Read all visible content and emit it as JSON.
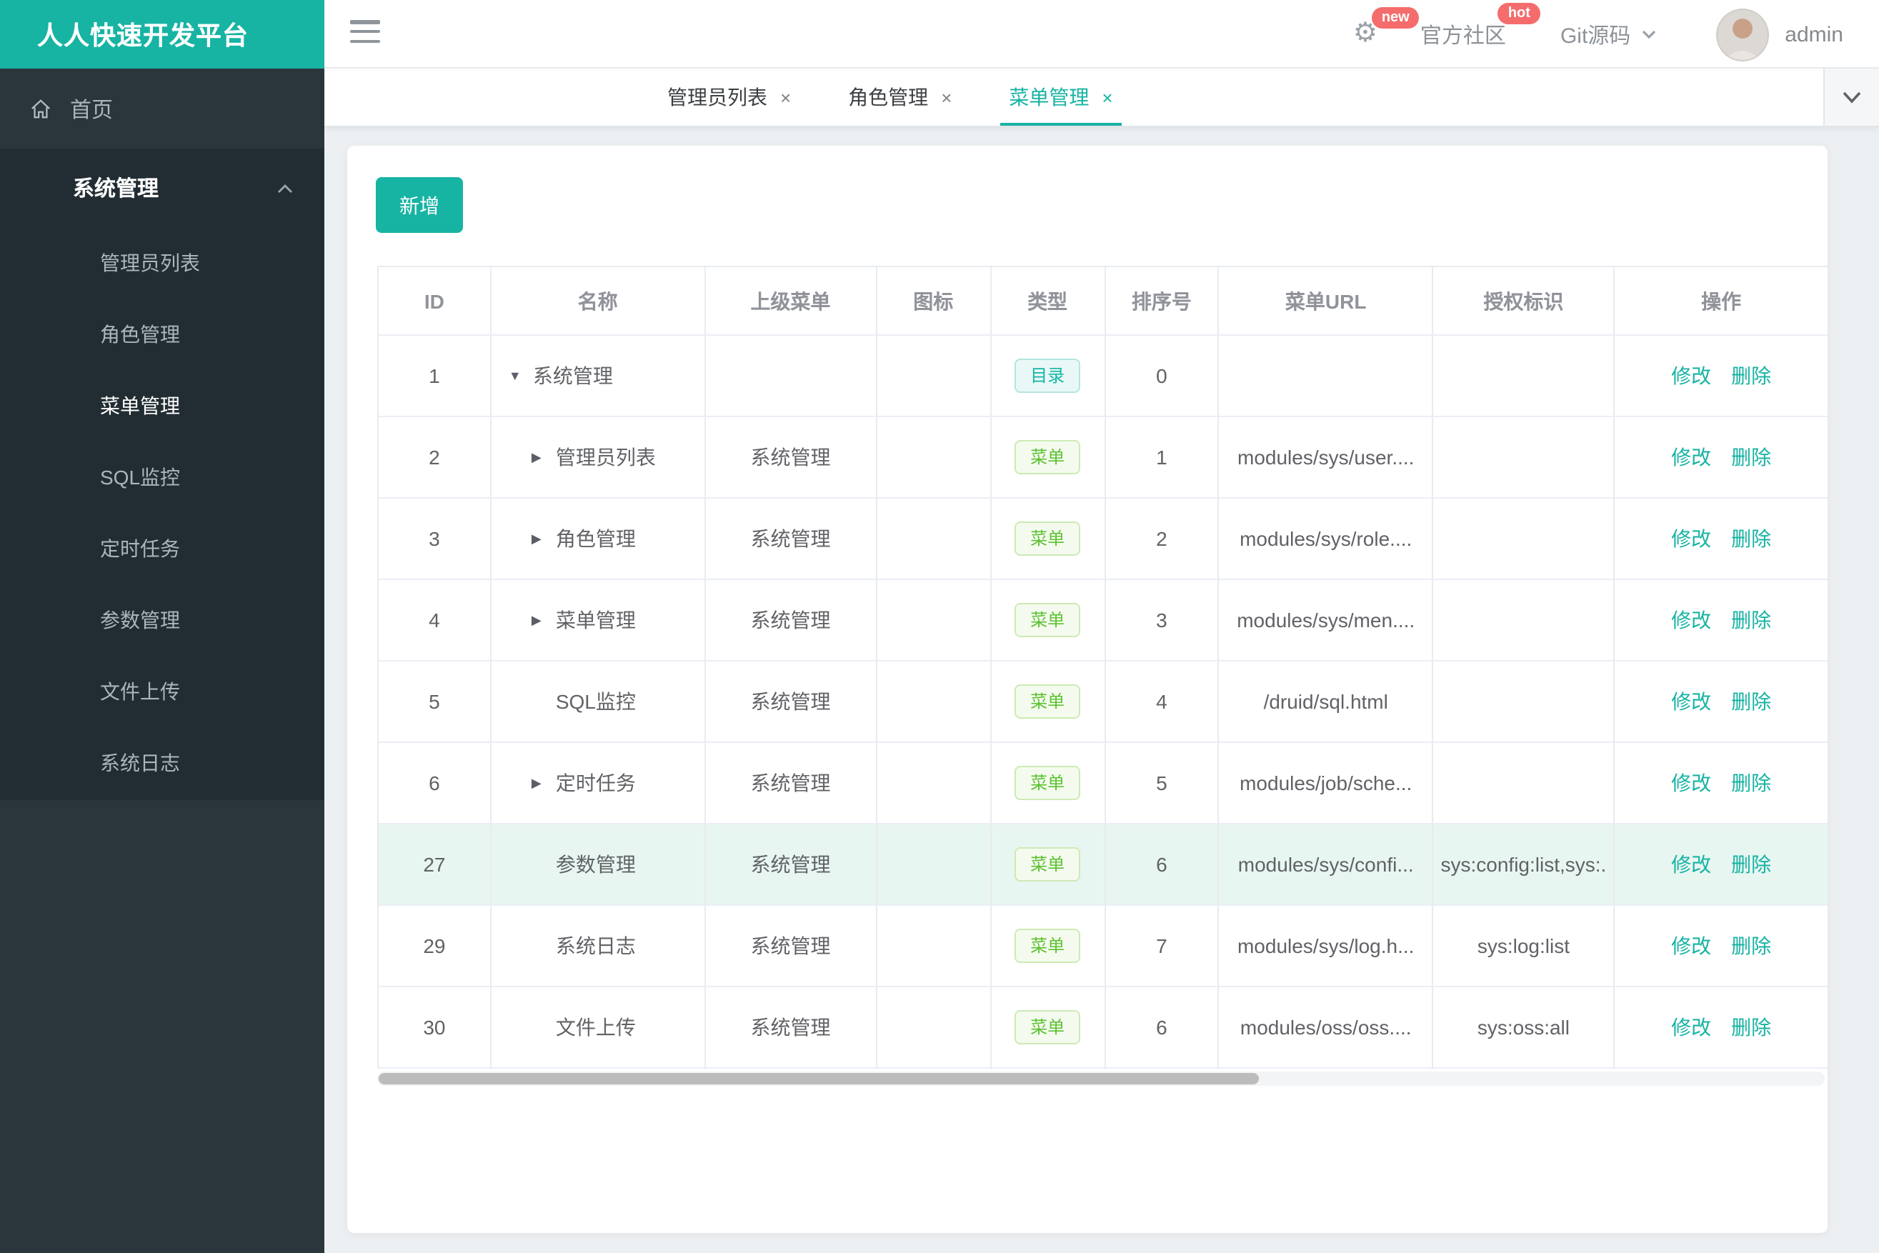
{
  "colors": {
    "accent": "#17b3a3",
    "badge_red": "#f56c6c",
    "page_bg": "#edf0f2",
    "sidebar_bg": "#2b353c",
    "sidebar_group_bg": "#222d33",
    "sidebar_text": "#aab6bd",
    "row_highlight": "#e8f6f1",
    "tag_dir_text": "#13b5a5",
    "tag_dir_bg": "#e9f8f6",
    "tag_dir_border": "#b2e6df",
    "tag_menu_text": "#5cc131",
    "tag_menu_bg": "#f4fbee",
    "tag_menu_border": "#cdeab4"
  },
  "icons": {
    "close": "×",
    "arrow_down": "▼",
    "arrow_right": "▶"
  },
  "brand": {
    "title": "人人快速开发平台"
  },
  "header": {
    "gear_badge": "new",
    "community_label": "官方社区",
    "community_badge": "hot",
    "git_label": "Git源码",
    "username": "admin"
  },
  "sidebar": {
    "home_label": "首页",
    "group": {
      "label": "系统管理",
      "expanded": true,
      "items": [
        {
          "key": "admin-list",
          "label": "管理员列表",
          "active": false
        },
        {
          "key": "role-mgmt",
          "label": "角色管理",
          "active": false
        },
        {
          "key": "menu-mgmt",
          "label": "菜单管理",
          "active": true
        },
        {
          "key": "sql-monitor",
          "label": "SQL监控",
          "active": false
        },
        {
          "key": "scheduled-tasks",
          "label": "定时任务",
          "active": false
        },
        {
          "key": "param-mgmt",
          "label": "参数管理",
          "active": false
        },
        {
          "key": "file-upload",
          "label": "文件上传",
          "active": false
        },
        {
          "key": "system-log",
          "label": "系统日志",
          "active": false
        }
      ]
    }
  },
  "tabs": [
    {
      "key": "admin-list",
      "label": "管理员列表",
      "active": false
    },
    {
      "key": "role-mgmt",
      "label": "角色管理",
      "active": false
    },
    {
      "key": "menu-mgmt",
      "label": "菜单管理",
      "active": true
    }
  ],
  "toolbar": {
    "add_label": "新增"
  },
  "table": {
    "columns": [
      "ID",
      "名称",
      "上级菜单",
      "图标",
      "类型",
      "排序号",
      "菜单URL",
      "授权标识",
      "操作"
    ],
    "actions": [
      "修改",
      "删除"
    ],
    "rows": [
      {
        "id": "1",
        "arrow": "down",
        "indent": 0,
        "name": "系统管理",
        "parent": "",
        "icon": "",
        "type": "目录",
        "type_style": "dir",
        "order": "0",
        "url": "",
        "perms": "",
        "highlight": false
      },
      {
        "id": "2",
        "arrow": "right",
        "indent": 1,
        "name": "管理员列表",
        "parent": "系统管理",
        "icon": "",
        "type": "菜单",
        "type_style": "menu",
        "order": "1",
        "url": "modules/sys/user....",
        "perms": "",
        "highlight": false
      },
      {
        "id": "3",
        "arrow": "right",
        "indent": 1,
        "name": "角色管理",
        "parent": "系统管理",
        "icon": "",
        "type": "菜单",
        "type_style": "menu",
        "order": "2",
        "url": "modules/sys/role....",
        "perms": "",
        "highlight": false
      },
      {
        "id": "4",
        "arrow": "right",
        "indent": 1,
        "name": "菜单管理",
        "parent": "系统管理",
        "icon": "",
        "type": "菜单",
        "type_style": "menu",
        "order": "3",
        "url": "modules/sys/men....",
        "perms": "",
        "highlight": false
      },
      {
        "id": "5",
        "arrow": "none",
        "indent": 1,
        "name": "SQL监控",
        "parent": "系统管理",
        "icon": "",
        "type": "菜单",
        "type_style": "menu",
        "order": "4",
        "url": "/druid/sql.html",
        "perms": "",
        "highlight": false
      },
      {
        "id": "6",
        "arrow": "right",
        "indent": 1,
        "name": "定时任务",
        "parent": "系统管理",
        "icon": "",
        "type": "菜单",
        "type_style": "menu",
        "order": "5",
        "url": "modules/job/sche...",
        "perms": "",
        "highlight": false
      },
      {
        "id": "27",
        "arrow": "none",
        "indent": 1,
        "name": "参数管理",
        "parent": "系统管理",
        "icon": "",
        "type": "菜单",
        "type_style": "menu",
        "order": "6",
        "url": "modules/sys/confi...",
        "perms": "sys:config:list,sys:.",
        "highlight": true
      },
      {
        "id": "29",
        "arrow": "none",
        "indent": 1,
        "name": "系统日志",
        "parent": "系统管理",
        "icon": "",
        "type": "菜单",
        "type_style": "menu",
        "order": "7",
        "url": "modules/sys/log.h...",
        "perms": "sys:log:list",
        "highlight": false
      },
      {
        "id": "30",
        "arrow": "none",
        "indent": 1,
        "name": "文件上传",
        "parent": "系统管理",
        "icon": "",
        "type": "菜单",
        "type_style": "menu",
        "order": "6",
        "url": "modules/oss/oss....",
        "perms": "sys:oss:all",
        "highlight": false
      }
    ]
  }
}
